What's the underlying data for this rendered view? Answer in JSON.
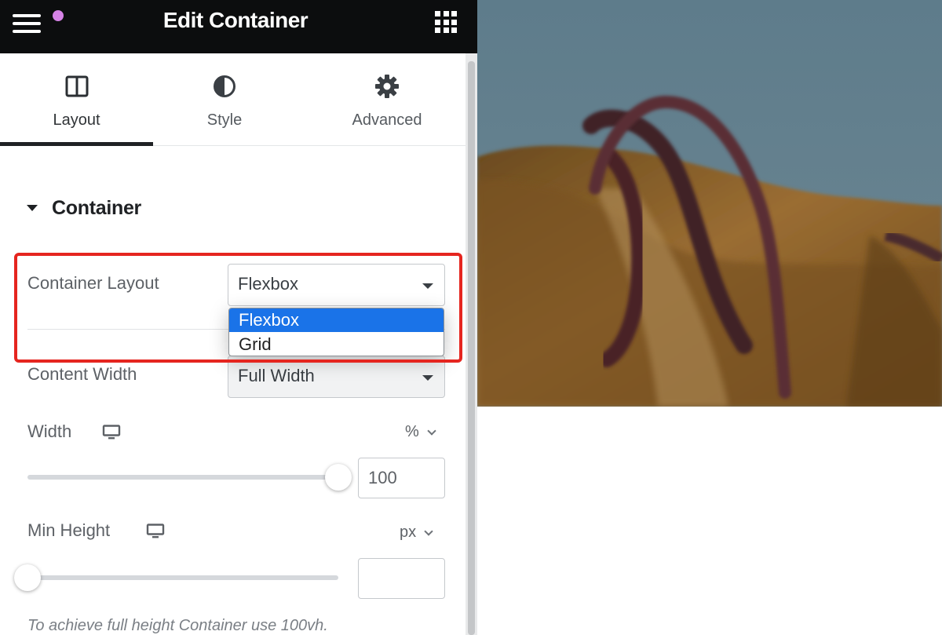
{
  "header": {
    "title": "Edit Container",
    "menu_icon": "hamburger-icon",
    "apps_icon": "apps-grid-icon"
  },
  "tabs": [
    {
      "label": "Layout",
      "icon": "layout-columns-icon",
      "active": true
    },
    {
      "label": "Style",
      "icon": "half-circle-icon",
      "active": false
    },
    {
      "label": "Advanced",
      "icon": "gear-icon",
      "active": false
    }
  ],
  "section": {
    "title": "Container",
    "expanded": true
  },
  "container_layout": {
    "label": "Container Layout",
    "value": "Flexbox",
    "options": [
      "Flexbox",
      "Grid"
    ],
    "highlighted_option": "Flexbox"
  },
  "content_width": {
    "label": "Content Width",
    "value": "Full Width"
  },
  "width": {
    "label": "Width",
    "unit": "%",
    "value": "100",
    "slider_fraction": 1.0,
    "device_icon": "desktop-monitor-icon"
  },
  "min_height": {
    "label": "Min Height",
    "unit": "px",
    "value": "",
    "slider_fraction": 0.0,
    "device_icon": "desktop-monitor-icon"
  },
  "hint": "To achieve full height Container use 100vh.",
  "colors": {
    "header_bg": "#0c0d0e",
    "highlight_border": "#e5251f",
    "selected_option_bg": "#1a73e8",
    "notification_dot": "#d683e6"
  }
}
